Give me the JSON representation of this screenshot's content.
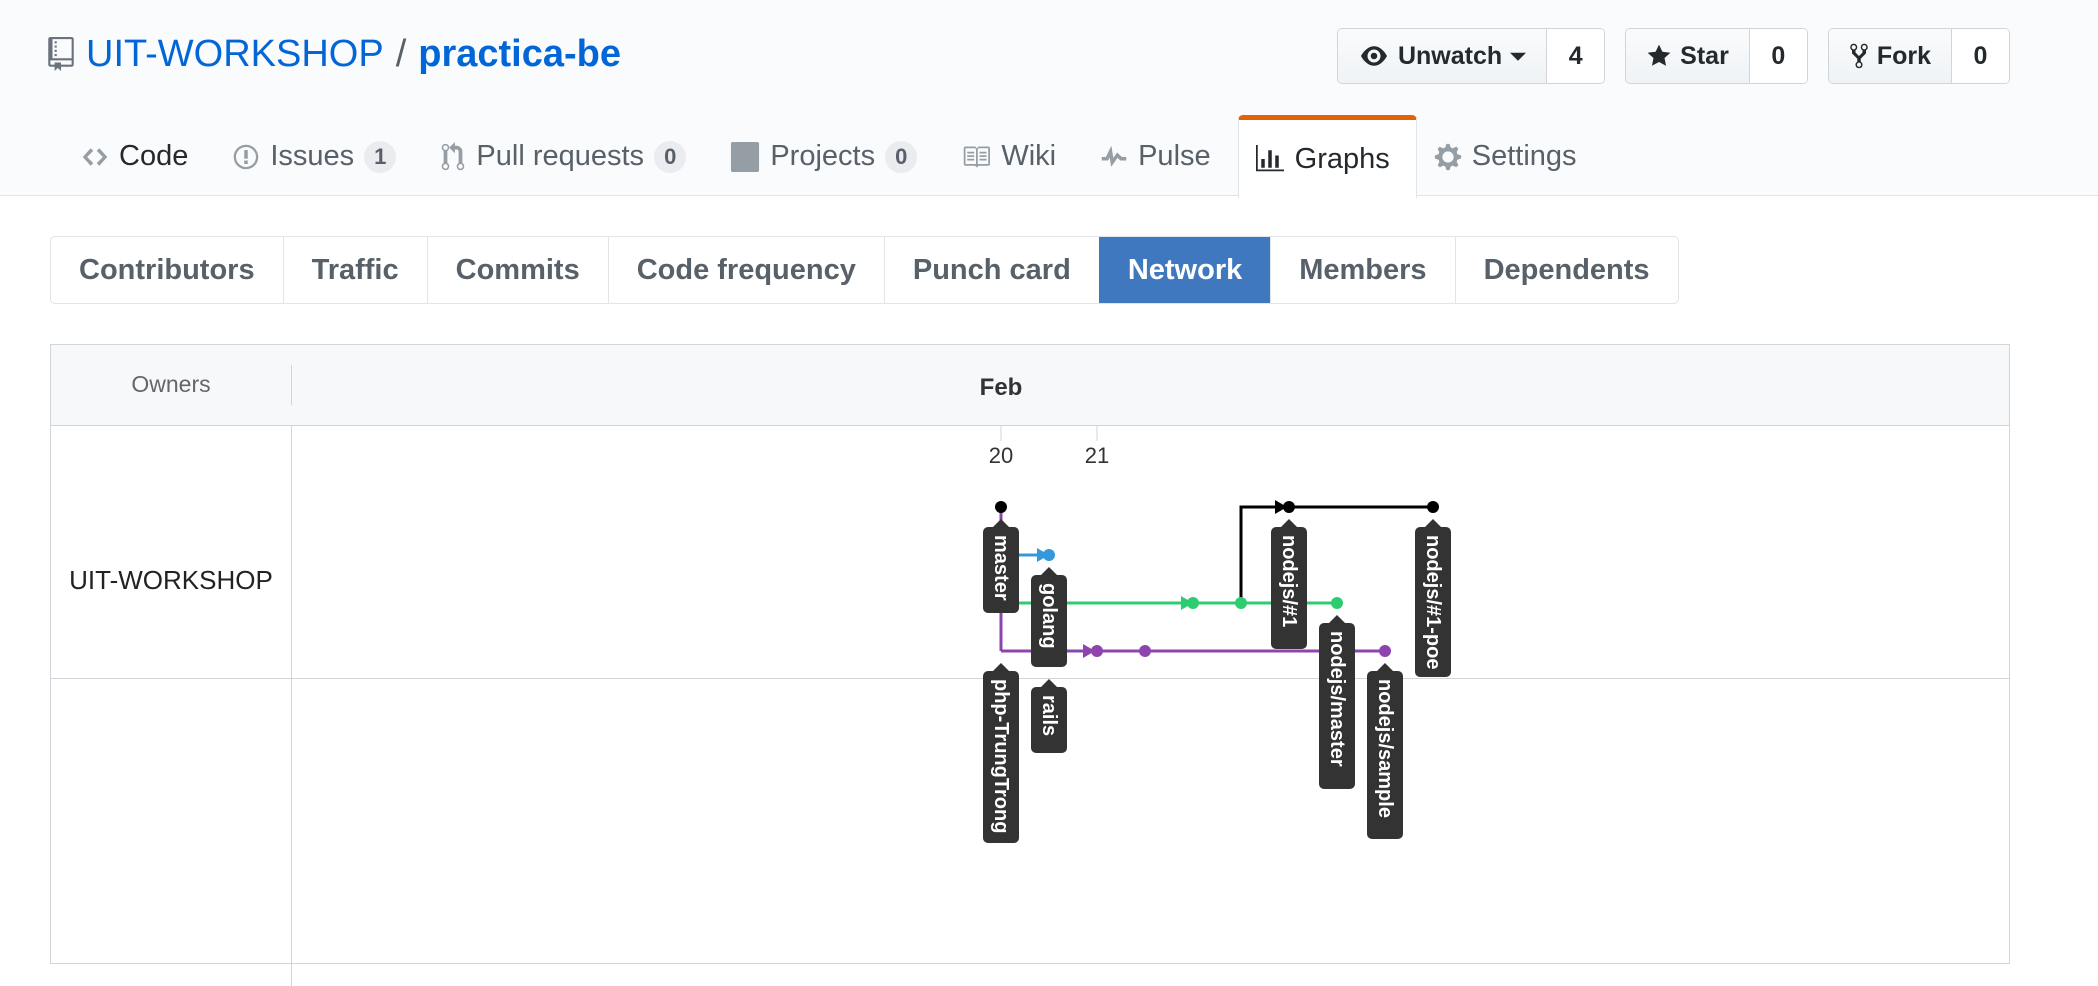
{
  "repo": {
    "owner": "UIT-WORKSHOP",
    "separator": "/",
    "name": "practica-be"
  },
  "actions": {
    "watch": {
      "label": "Unwatch",
      "count": "4"
    },
    "star": {
      "label": "Star",
      "count": "0"
    },
    "fork": {
      "label": "Fork",
      "count": "0"
    }
  },
  "nav": {
    "code": "Code",
    "issues": "Issues",
    "issues_count": "1",
    "pulls": "Pull requests",
    "pulls_count": "0",
    "projects": "Projects",
    "projects_count": "0",
    "wiki": "Wiki",
    "pulse": "Pulse",
    "graphs": "Graphs",
    "settings": "Settings"
  },
  "graph_tabs": {
    "contributors": "Contributors",
    "traffic": "Traffic",
    "commits": "Commits",
    "code_frequency": "Code frequency",
    "punch_card": "Punch card",
    "network": "Network",
    "members": "Members",
    "dependents": "Dependents"
  },
  "network": {
    "owners_header": "Owners",
    "month": "Feb",
    "days": [
      "20",
      "21"
    ],
    "owners": [
      "UIT-WORKSHOP"
    ],
    "branch_labels": [
      "master",
      "golang",
      "php-TrungTrong",
      "rails",
      "nodejs/#1",
      "nodejs/master",
      "nodejs/sample",
      "nodejs/#1-poe"
    ],
    "colors": {
      "master": "#000000",
      "golang": "#3498db",
      "nodejs": "#2ecc71",
      "php": "#8e44ad",
      "label_bg": "#333333"
    }
  }
}
